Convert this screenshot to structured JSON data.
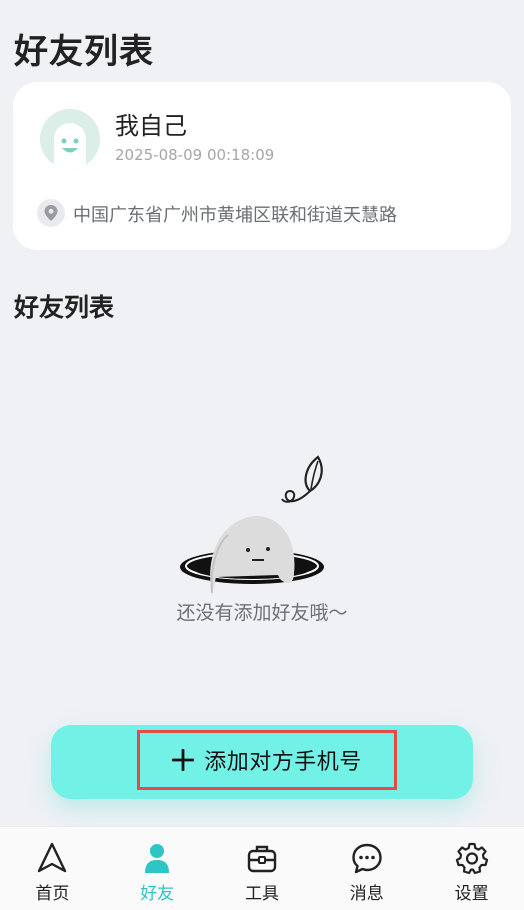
{
  "header": {
    "title": "好友列表"
  },
  "self_card": {
    "name": "我自己",
    "timestamp": "2025-08-09 00:18:09",
    "location": "中国广东省广州市黄埔区联和街道天慧路",
    "avatar_icon": "smiley-avatar-icon",
    "location_icon": "map-pin-icon"
  },
  "friends": {
    "section_title": "好友列表",
    "empty_text": "还没有添加好友哦～",
    "items": []
  },
  "add_button": {
    "label": "添加对方手机号",
    "icon": "plus-icon"
  },
  "tabbar": {
    "items": [
      {
        "label": "首页",
        "icon": "navigation-arrow-icon",
        "active": false
      },
      {
        "label": "好友",
        "icon": "person-icon",
        "active": true
      },
      {
        "label": "工具",
        "icon": "toolbox-icon",
        "active": false
      },
      {
        "label": "消息",
        "icon": "chat-bubble-icon",
        "active": false
      },
      {
        "label": "设置",
        "icon": "gear-icon",
        "active": false
      }
    ]
  },
  "colors": {
    "accent": "#2ec5c5",
    "button_bg": "#72f2e6",
    "highlight_border": "#e34a4a",
    "page_bg": "#f0f1f5"
  }
}
